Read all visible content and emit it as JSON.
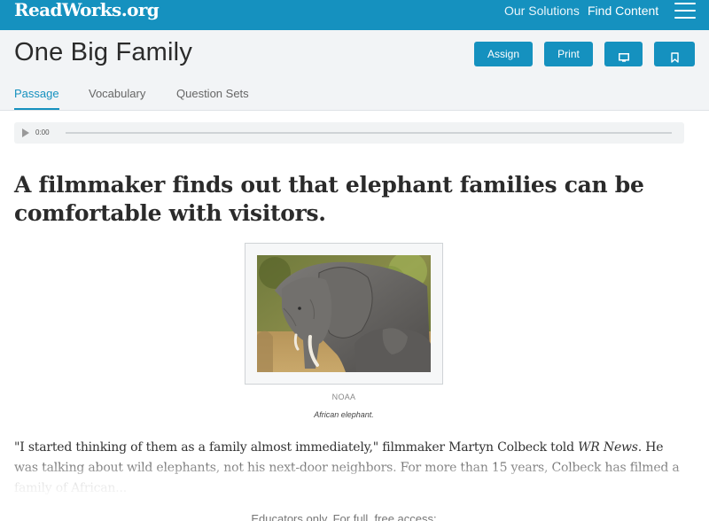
{
  "topbar": {
    "logo": "ReadWorks.org",
    "nav": [
      "Our Solutions",
      "Find Content"
    ]
  },
  "header": {
    "title": "One Big Family",
    "buttons": {
      "assign": "Assign",
      "print": "Print"
    },
    "tabs": [
      "Passage",
      "Vocabulary",
      "Question Sets"
    ],
    "active_tab": "Passage"
  },
  "audio": {
    "time": "0:00",
    "progress": 0
  },
  "article": {
    "headline": "A filmmaker finds out that elephant families can be comfortable with visitors.",
    "figure": {
      "credit": "NOAA",
      "caption": "African elephant."
    },
    "paragraph_start": "\"I started thinking of them as a family almost immediately,\" filmmaker Martyn Colbeck told ",
    "publication": "WR News",
    "paragraph_end": ". He was talking about wild elephants, not his next-door neighbors. For more than 15 years, Colbeck has filmed a family of African..."
  },
  "footer": {
    "note": "Educators only. For full, free access:"
  },
  "colors": {
    "brand": "#1591bf",
    "header_bg": "#f2f4f6"
  }
}
